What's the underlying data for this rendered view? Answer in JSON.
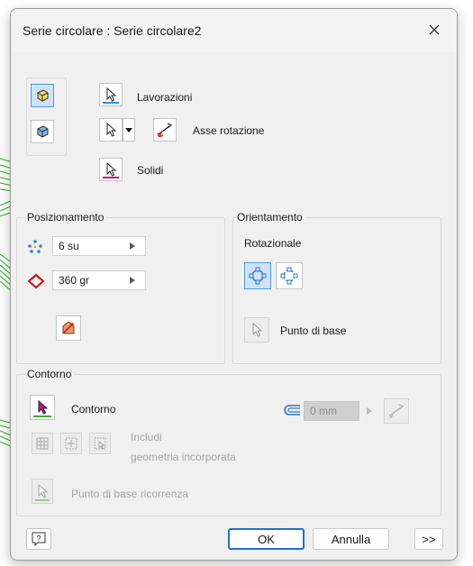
{
  "window": {
    "title": "Serie circolare : Serie circolare2"
  },
  "selection": {
    "features_label": "Lavorazioni",
    "axis_label": "Asse rotazione",
    "solids_label": "Solidi"
  },
  "placement": {
    "title": "Posizionamento",
    "count_value": "6 su",
    "angle_value": "360 gr"
  },
  "orientation": {
    "title": "Orientamento",
    "rotational_label": "Rotazionale",
    "base_point_label": "Punto di base"
  },
  "boundary": {
    "title": "Contorno",
    "boundary_label": "Contorno",
    "offset_value": "0 mm",
    "include_line1": "Includi",
    "include_line2": "geometria incorporata",
    "base_point_label": "Punto di base ricorrenza"
  },
  "footer": {
    "ok_label": "OK",
    "cancel_label": "Annulla",
    "more_label": ">>"
  },
  "colors": {
    "blue_underline": "#2f8be0",
    "magenta_underline": "#c0168f",
    "green_underline": "#3daa3d",
    "accent": "#1f6fd0"
  }
}
